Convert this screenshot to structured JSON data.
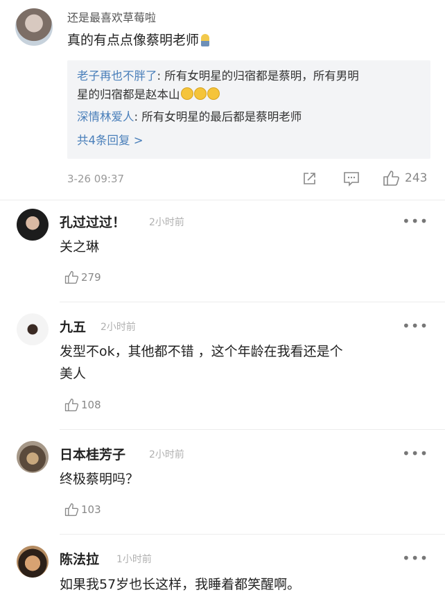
{
  "top_comment": {
    "username": "还是最喜欢草莓啦",
    "text": "真的有点点像蔡明老师",
    "replies": [
      {
        "user": "老子再也不胖了",
        "text": ": 所有女明星的归宿都是蔡明，所有男明",
        "text_cont": "星的归宿都是赵本山"
      },
      {
        "user": "深情林爱人",
        "text": ": 所有女明星的最后都是蔡明老师"
      }
    ],
    "more_replies": "共4条回复 >",
    "timestamp": "3-26 09:37",
    "like_count": "243"
  },
  "comments": [
    {
      "username": "孔过过过！",
      "time": "2小时前",
      "text": "关之琳",
      "likes": "279"
    },
    {
      "username": "九五",
      "time": "2小时前",
      "text": "发型不ok，其他都不错 ，这个年龄在我看还是个",
      "text_cont": "美人",
      "likes": "108"
    },
    {
      "username": "日本桂芳子",
      "time": "2小时前",
      "text": "终极蔡明吗？",
      "likes": "103"
    },
    {
      "username": "陈法拉",
      "time": "1小时前",
      "text": "如果我57岁也长这样，我睡着都笑醒啊。"
    }
  ],
  "more_label": "•••"
}
